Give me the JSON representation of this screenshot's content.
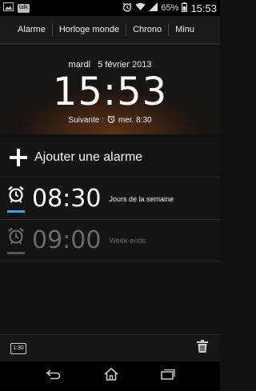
{
  "status_bar": {
    "app_icons": [
      "image-icon",
      "talk-icon"
    ],
    "talk_label": "talk",
    "battery_percent": "65%",
    "time": "15:53"
  },
  "tabs": [
    {
      "label": "Alarme",
      "active": true
    },
    {
      "label": "Horloge monde",
      "active": false
    },
    {
      "label": "Chrono",
      "active": false
    },
    {
      "label": "Minu",
      "active": false
    }
  ],
  "clock": {
    "date": "mardi   5 février 2013",
    "time": "15:53",
    "next_label": "Suivante :",
    "next_alarm": "mer. 8:30"
  },
  "add_alarm": {
    "label": "Ajouter une alarme"
  },
  "alarms": [
    {
      "time": "08:30",
      "days": "Jours de la semaine",
      "enabled": true
    },
    {
      "time": "09:00",
      "days": "Week-ends",
      "enabled": false
    }
  ],
  "bottom_bar": {
    "format_label": "1:30"
  },
  "colors": {
    "accent_on": "#3aa6e0",
    "accent_off": "#555555",
    "text_off": "#6a6a6a"
  }
}
